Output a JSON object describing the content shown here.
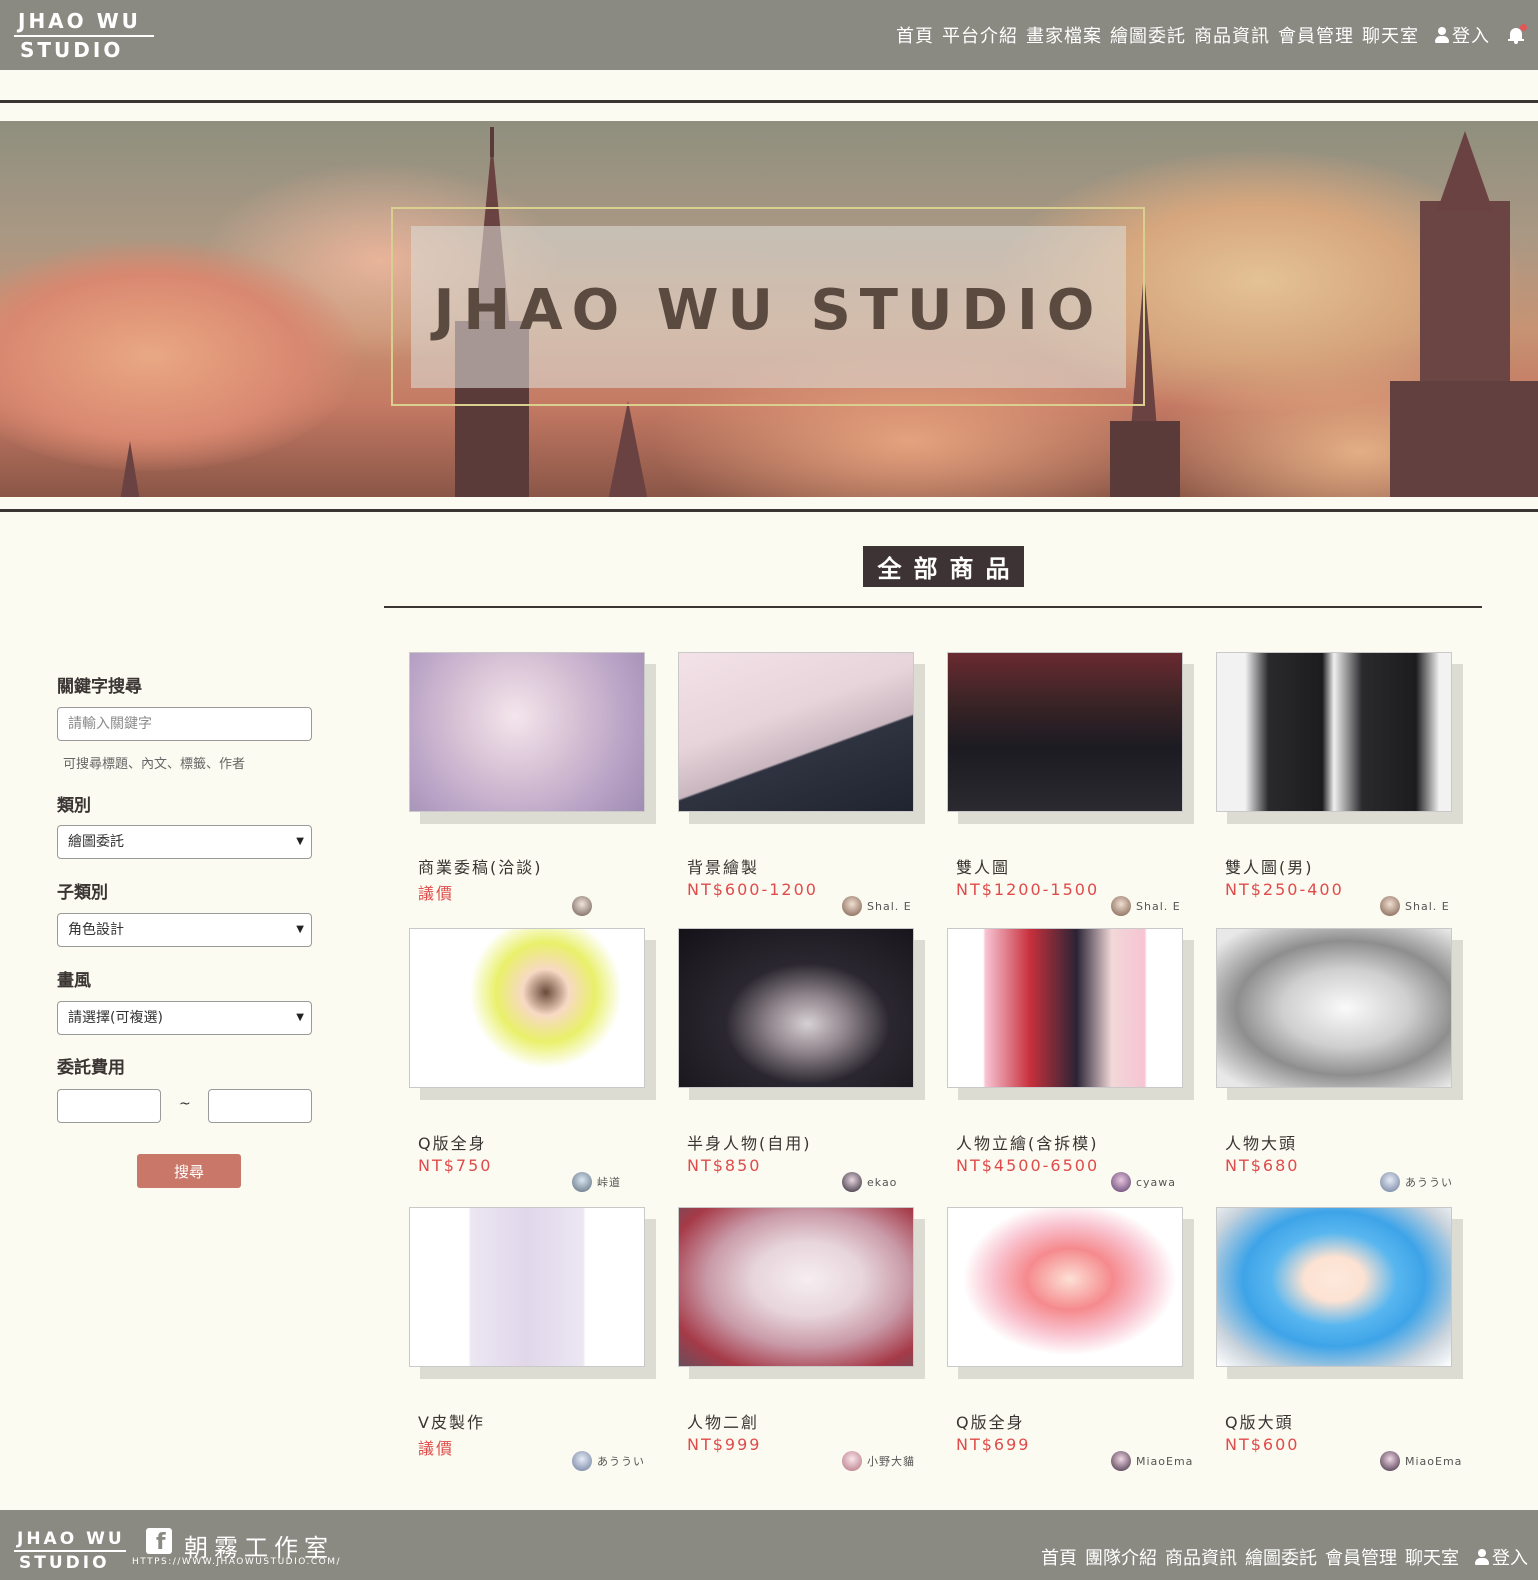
{
  "header": {
    "logo_line1": "JHAO WU",
    "logo_line2": "STUDIO",
    "nav": [
      "首頁",
      "平台介紹",
      "畫家檔案",
      "繪圖委託",
      "商品資訊",
      "會員管理",
      "聊天室"
    ],
    "login": "登入",
    "icons": {
      "user": "user-icon",
      "notification": "bell-icon"
    }
  },
  "banner": {
    "title": "JHAO WU STUDIO"
  },
  "section": {
    "title": "全部商品"
  },
  "sidebar": {
    "keyword_label": "關鍵字搜尋",
    "keyword_placeholder": "請輸入關鍵字",
    "keyword_hint": "可搜尋標題、內文、標籤、作者",
    "category_label": "類別",
    "category_value": "繪圖委託",
    "subcategory_label": "子類別",
    "subcategory_value": "角色設計",
    "style_label": "畫風",
    "style_value": "請選擇(可複選)",
    "fee_label": "委託費用",
    "fee_separator": "~",
    "search_button": "搜尋"
  },
  "products": [
    {
      "title": "商業委稿(洽談)",
      "price": "議價",
      "author": ""
    },
    {
      "title": "背景繪製",
      "price": "NT$600-1200",
      "author": "Shal. E"
    },
    {
      "title": "雙人圖",
      "price": "NT$1200-1500",
      "author": "Shal. E"
    },
    {
      "title": "雙人圖(男)",
      "price": "NT$250-400",
      "author": "Shal. E"
    },
    {
      "title": "Q版全身",
      "price": "NT$750",
      "author": "峠道"
    },
    {
      "title": "半身人物(自用)",
      "price": "NT$850",
      "author": "ekao"
    },
    {
      "title": "人物立繪(含拆模)",
      "price": "NT$4500-6500",
      "author": "cyawa"
    },
    {
      "title": "人物大頭",
      "price": "NT$680",
      "author": "あううい"
    },
    {
      "title": "V皮製作",
      "price": "議價",
      "author": "あううい"
    },
    {
      "title": "人物二創",
      "price": "NT$999",
      "author": "小野大貓"
    },
    {
      "title": "Q版全身",
      "price": "NT$699",
      "author": "MiaoEma"
    },
    {
      "title": "Q版大頭",
      "price": "NT$600",
      "author": "MiaoEma"
    }
  ],
  "footer": {
    "logo_line1": "JHAO WU",
    "logo_line2": "STUDIO",
    "fb_name": "朝霧工作室",
    "url": "HTTPS://WWW.JHAOWUSTUDIO.COM/",
    "nav": [
      "首頁",
      "團隊介紹",
      "商品資訊",
      "繪圖委託",
      "會員管理",
      "聊天室"
    ],
    "login": "登入",
    "icons": {
      "facebook": "facebook-icon",
      "user": "user-icon"
    }
  },
  "colors": {
    "bar": "#8a8a82",
    "page_bg": "#fbfbf1",
    "accent_dark": "#3d3334",
    "price_red": "#e04b4b",
    "button": "#c87768"
  }
}
